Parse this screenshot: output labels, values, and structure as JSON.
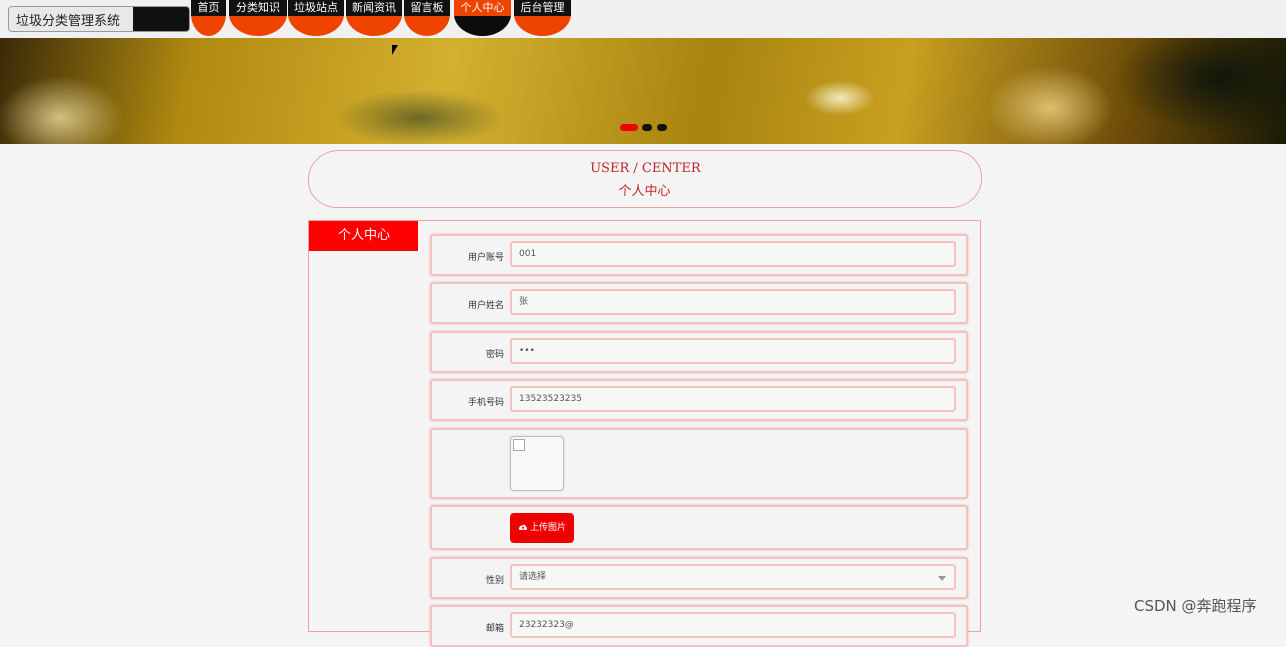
{
  "app": {
    "title": "垃圾分类管理系统"
  },
  "nav": {
    "items": [
      {
        "label": "首页"
      },
      {
        "label": "分类知识"
      },
      {
        "label": "垃圾站点"
      },
      {
        "label": "新闻资讯"
      },
      {
        "label": "留言板"
      },
      {
        "label": "个人中心"
      },
      {
        "label": "后台管理"
      }
    ],
    "active_index": 5
  },
  "banner": {
    "dots": 3,
    "active_dot": 0,
    "accent": "#ee0000"
  },
  "page_title": {
    "en": "USER / CENTER",
    "cn": "个人中心"
  },
  "sidebar": {
    "heading": "个人中心"
  },
  "form": {
    "account": {
      "label": "用户账号",
      "value": "001"
    },
    "name": {
      "label": "用户姓名",
      "value": "张"
    },
    "password": {
      "label": "密码",
      "value": "•••"
    },
    "phone": {
      "label": "手机号码",
      "value": "13523523235"
    },
    "avatar": {
      "icon": "broken-image-icon"
    },
    "upload": {
      "label": "上传图片",
      "icon": "cloud-upload-icon"
    },
    "gender": {
      "label": "性别",
      "placeholder": "请选择"
    },
    "email": {
      "label": "邮箱",
      "value": "23232323@"
    }
  },
  "watermark": "CSDN @奔跑程序",
  "colors": {
    "nav_orange": "#ee4400",
    "nav_dark": "#111111",
    "accent_red": "#ff0000",
    "border_pink": "#f0a0a0",
    "title_red": "#c0262b"
  }
}
